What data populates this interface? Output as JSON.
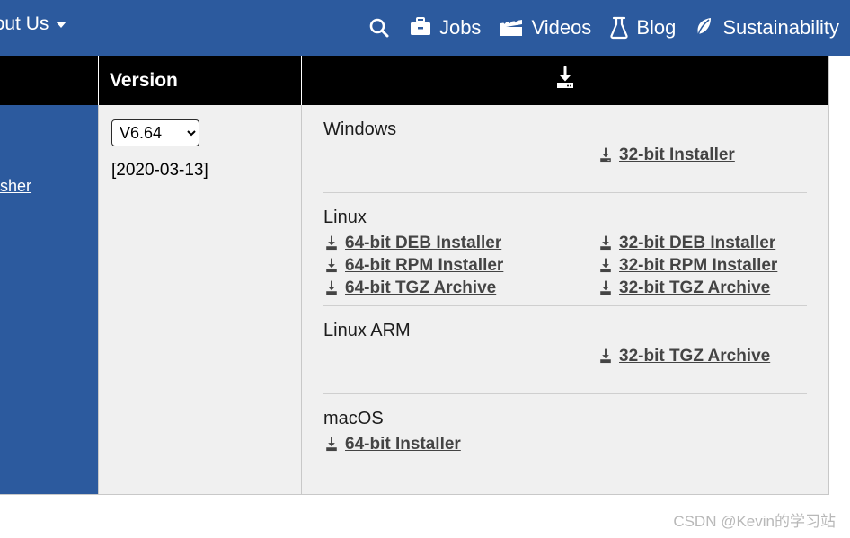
{
  "navbar": {
    "left_menu": {
      "label": "bout Us",
      "caret_icon": "chevron-down-icon"
    },
    "items": [
      {
        "label": "",
        "icon": "search-icon"
      },
      {
        "label": "Jobs",
        "icon": "briefcase-icon"
      },
      {
        "label": "Videos",
        "icon": "clapperboard-icon"
      },
      {
        "label": "Blog",
        "icon": "flask-icon"
      },
      {
        "label": "Sustainability",
        "icon": "leaf-icon"
      }
    ],
    "background_color": "#2c5a9e"
  },
  "table": {
    "headers": {
      "blank": "",
      "version": "Version",
      "download_icon": "download-icon"
    },
    "sidebar": {
      "link_label": "lasher",
      "background_color": "#2c5a9e"
    },
    "version_cell": {
      "selected_version": "V6.64",
      "options": [
        "V6.64"
      ],
      "release_date": "[2020-03-13]"
    },
    "downloads": [
      {
        "os": "Windows",
        "links": [
          {
            "label": "32-bit Installer",
            "column": "right",
            "icon": "download-icon"
          }
        ]
      },
      {
        "os": "Linux",
        "links": [
          {
            "label": "64-bit DEB Installer",
            "column": "left",
            "icon": "download-icon"
          },
          {
            "label": "32-bit DEB Installer",
            "column": "right",
            "icon": "download-icon"
          },
          {
            "label": "64-bit RPM Installer",
            "column": "left",
            "icon": "download-icon"
          },
          {
            "label": "32-bit RPM Installer",
            "column": "right",
            "icon": "download-icon"
          },
          {
            "label": "64-bit TGZ Archive",
            "column": "left",
            "icon": "download-icon"
          },
          {
            "label": "32-bit TGZ Archive",
            "column": "right",
            "icon": "download-icon"
          }
        ]
      },
      {
        "os": "Linux ARM",
        "links": [
          {
            "label": "32-bit TGZ Archive",
            "column": "right",
            "icon": "download-icon"
          }
        ]
      },
      {
        "os": "macOS",
        "links": [
          {
            "label": "64-bit Installer",
            "column": "left",
            "icon": "download-icon"
          }
        ]
      }
    ]
  },
  "watermark": {
    "text": "CSDN @Kevin的学习站"
  }
}
